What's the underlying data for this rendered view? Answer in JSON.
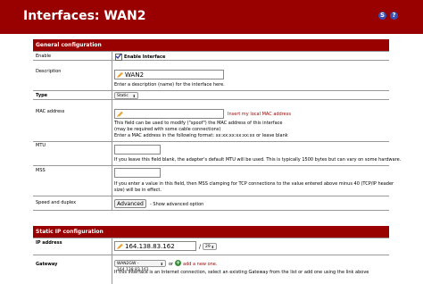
{
  "header": {
    "title": "Interfaces: WAN2"
  },
  "general": {
    "section_title": "General configuration",
    "enable": {
      "label": "Enable",
      "checkbox_label": "Enable Interface"
    },
    "description": {
      "label": "Description",
      "value": "WAN2",
      "help": "Enter a description (name) for the interface here."
    },
    "type": {
      "label": "Type",
      "value": "Static"
    },
    "mac": {
      "label": "MAC address",
      "link": "Insert my local MAC address",
      "help1": "This field can be used to modify (\"spoof\") the MAC address of this interface",
      "help2": "(may be required with some cable connections)",
      "help3": "Enter a MAC address in the following format: xx:xx:xx:xx:xx:xx or leave blank"
    },
    "mtu": {
      "label": "MTU",
      "help": "If you leave this field blank, the adapter's default MTU will be used. This is typically 1500 bytes but can vary on some hardware."
    },
    "mss": {
      "label": "MSS",
      "help1": "If you enter a value in this field, then MSS clamping for TCP connections to the value entered above minus 40 (TCP/IP header",
      "help2": "size) will be in effect."
    },
    "speed": {
      "label": "Speed and duplex",
      "button": "Advanced",
      "help": "- Show advanced option"
    }
  },
  "static": {
    "section_title": "Static IP configuration",
    "ip": {
      "label": "IP address",
      "value": "164.138.83.162",
      "prefix": "29"
    },
    "gateway": {
      "label": "Gateway",
      "value": "WAN2GW - 164.138.83.161",
      "or_text": "or",
      "add_link": "add a new one.",
      "help": "If this interface is an Internet connection, select an existing Gateway from the list or add one using the link above"
    }
  },
  "colors": {
    "header_bg": "#990000",
    "link": "#990000",
    "accent_blue": "#3a4fb0"
  }
}
